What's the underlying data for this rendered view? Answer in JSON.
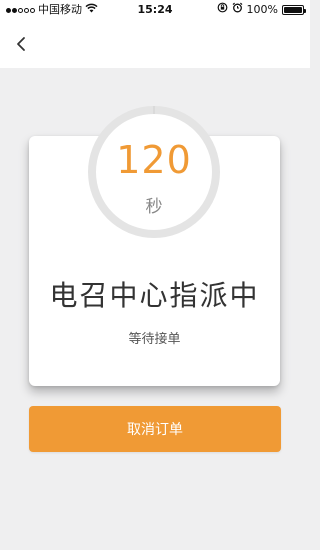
{
  "status_bar": {
    "carrier": "中国移动",
    "time": "15:24",
    "battery_percent": "100%",
    "battery_level": 1.0,
    "signal_bars": 2,
    "signal_bars_total": 5
  },
  "nav": {
    "back_icon": "chevron-left-icon"
  },
  "timer": {
    "value": "120",
    "unit": "秒",
    "ring_progress": 0.0,
    "ring_color": "#e4e4e4",
    "accent_color": "#f09a35"
  },
  "card": {
    "title": "电召中心指派中",
    "subtitle": "等待接单"
  },
  "actions": {
    "cancel_label": "取消订单",
    "button_color": "#f09a35"
  }
}
